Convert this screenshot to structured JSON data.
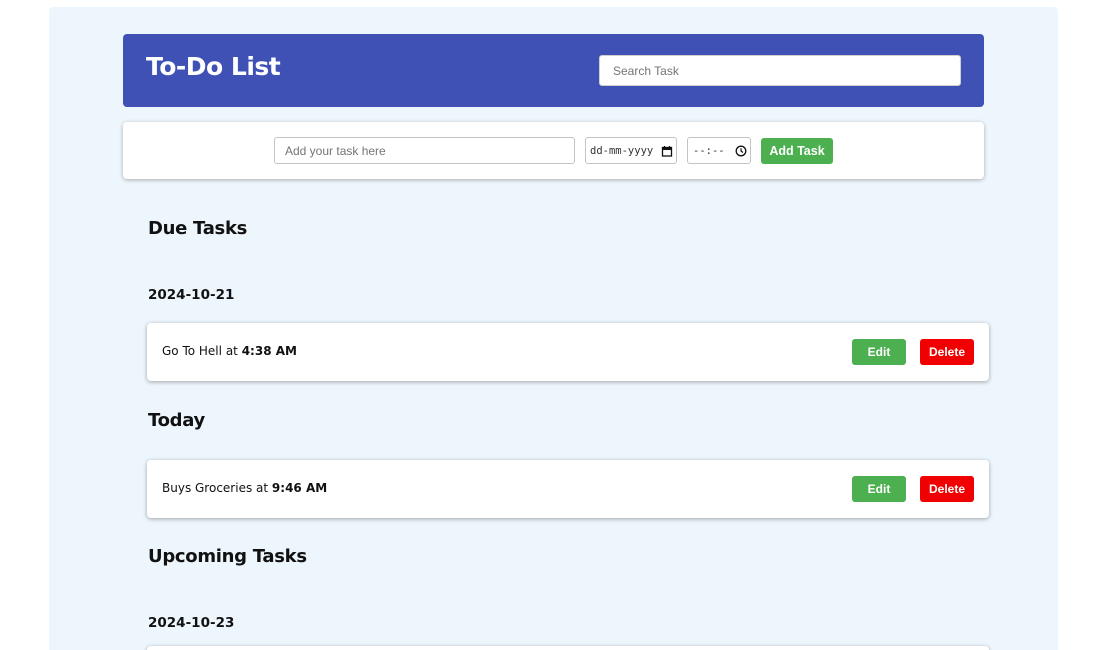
{
  "header": {
    "title": "To-Do List",
    "search_placeholder": "Search Task"
  },
  "add_form": {
    "task_placeholder": "Add your task here",
    "date_placeholder": "dd-mm-yyyy",
    "time_placeholder": "--:--",
    "add_label": "Add Task"
  },
  "sections": {
    "due": {
      "heading": "Due Tasks",
      "date": "2024-10-21",
      "task": {
        "name": "Go To Hell",
        "connector": "at",
        "time": "4:38 AM"
      }
    },
    "today": {
      "heading": "Today",
      "task": {
        "name": "Buys Groceries",
        "connector": "at",
        "time": "9:46 AM"
      }
    },
    "upcoming": {
      "heading": "Upcoming Tasks",
      "date": "2024-10-23"
    }
  },
  "buttons": {
    "edit_label": "Edit",
    "delete_label": "Delete"
  },
  "colors": {
    "header_bg": "#3f51b5",
    "page_bg": "#eef6fd",
    "primary_green": "#4caf50",
    "danger_red": "#f00000"
  },
  "icons": {
    "date": "calendar-icon",
    "time": "clock-icon"
  }
}
